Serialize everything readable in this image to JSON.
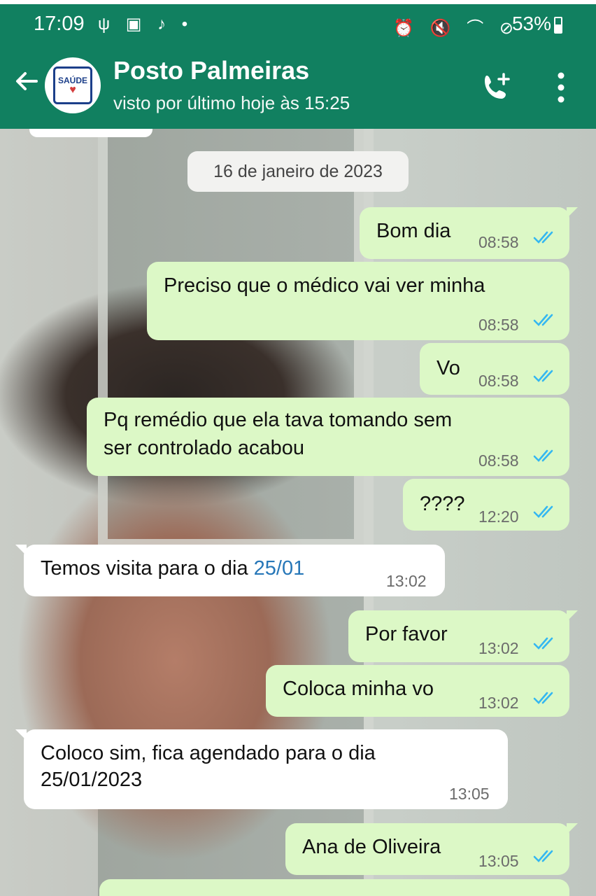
{
  "status_bar": {
    "time": "17:09",
    "left_icons": "ψ ▣ ♪ •",
    "right_icons": "⏰ 🔇 ⌒ ⊘",
    "battery": "53%"
  },
  "header": {
    "contact_name": "Posto Palmeiras",
    "last_seen": "visto por último hoje às 15:25",
    "avatar_logo_text": "SAÚDE",
    "icons": [
      "back-arrow-icon",
      "add-call-icon",
      "more-vert-icon"
    ]
  },
  "colors": {
    "header_bg": "#118060",
    "outgoing_bubble": "#dcf8c6",
    "incoming_bubble": "#ffffff",
    "read_ticks": "#34b7f1",
    "link": "#2777b8"
  },
  "chat": {
    "date_label": "16 de janeiro de 2023",
    "messages": [
      {
        "dir": "out",
        "text": "Bom dia",
        "time": "08:58",
        "read": true
      },
      {
        "dir": "out",
        "text": "Preciso que o médico vai ver minha",
        "time": "08:58",
        "read": true
      },
      {
        "dir": "out",
        "text": "Vo",
        "time": "08:58",
        "read": true
      },
      {
        "dir": "out",
        "line1": "Pq remédio  que ela tava tomando sem",
        "line2": "ser controlado acabou",
        "time": "08:58",
        "read": true
      },
      {
        "dir": "out",
        "text": "????",
        "time": "12:20",
        "read": true
      },
      {
        "dir": "in",
        "text_before": "Temos visita para o dia ",
        "link": "25/01",
        "time": "13:02"
      },
      {
        "dir": "out",
        "text": "Por favor",
        "time": "13:02",
        "read": true
      },
      {
        "dir": "out",
        "text": "Coloca minha vo",
        "time": "13:02",
        "read": true
      },
      {
        "dir": "in",
        "line1": "Coloco sim, fica agendado para o dia",
        "line2": "25/01/2023",
        "time": "13:05"
      },
      {
        "dir": "out",
        "text": "Ana de Oliveira",
        "time": "13:05",
        "read": true
      }
    ]
  }
}
